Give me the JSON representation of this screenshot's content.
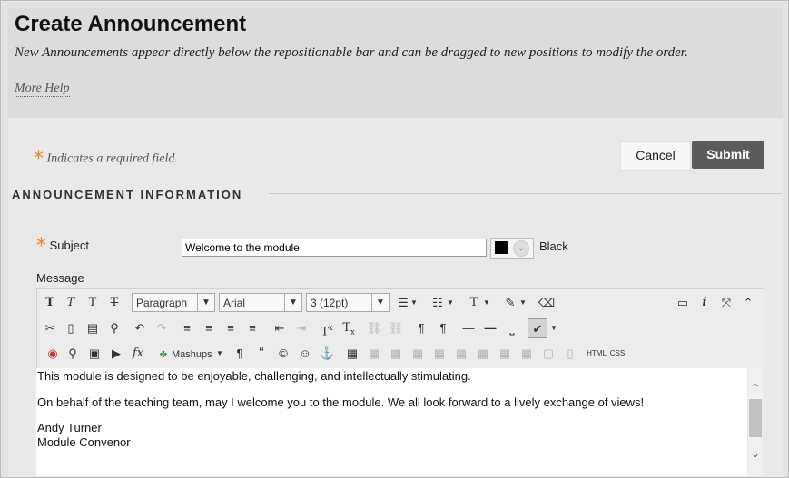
{
  "page": {
    "title": "Create Announcement",
    "description": "New Announcements appear directly below the repositionable bar and can be dragged to new positions to modify the order.",
    "more_help": "More Help"
  },
  "form": {
    "required_note": "Indicates a required field.",
    "cancel_label": "Cancel",
    "submit_label": "Submit",
    "section_title": "ANNOUNCEMENT INFORMATION",
    "subject_label": "Subject",
    "subject_value": "Welcome to the module",
    "color_label": "Black",
    "color_value": "#000000",
    "message_label": "Message"
  },
  "toolbar": {
    "format": "Paragraph",
    "font": "Arial",
    "size": "3 (12pt)",
    "mashups": "Mashups",
    "html_label": "HTML",
    "css_label": "CSS",
    "icons": {
      "bold": "T",
      "italic": "T",
      "underline": "T",
      "strike": "T",
      "cut": "✂",
      "copy": "▢",
      "paste": "▤",
      "find": "⚲",
      "undo": "↶",
      "redo": "↷",
      "sup": "T",
      "sub": "T",
      "anchor": "⚓",
      "pilcrow": "¶",
      "quote": "“",
      "copyright": "©",
      "smiley": "☺",
      "fx": "fx"
    }
  },
  "editor": {
    "lines": [
      "This module is designed to be enjoyable, challenging, and intellectually stimulating.",
      "On behalf of the teaching team, may I welcome you to the module. We all look forward to a lively exchange of views!",
      "Andy Turner",
      "Module Convenor"
    ]
  }
}
